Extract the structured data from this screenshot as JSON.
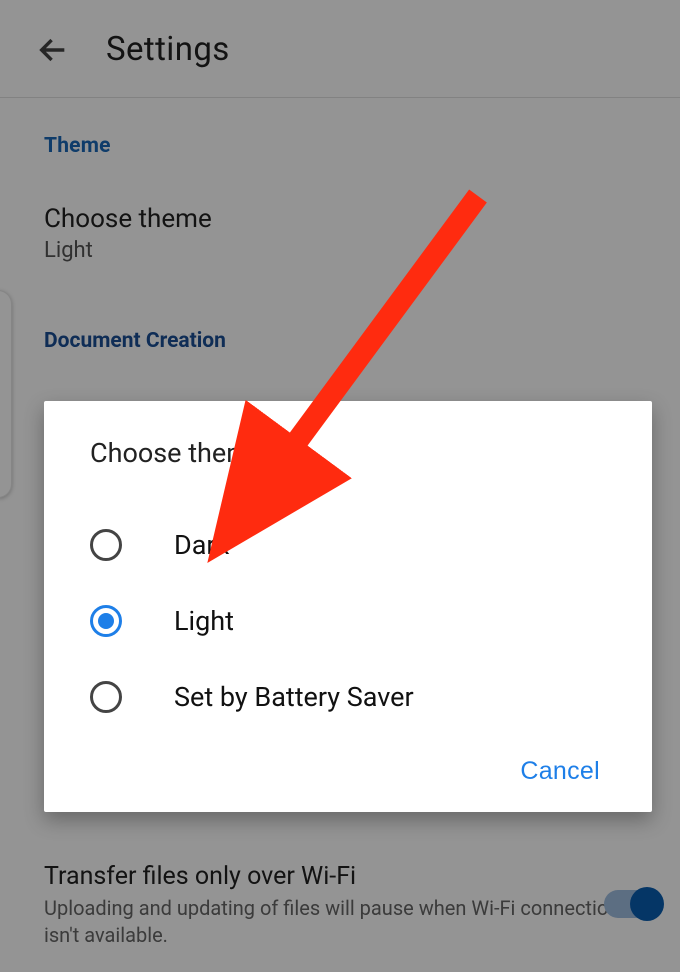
{
  "header": {
    "title": "Settings"
  },
  "sections": {
    "theme_head": "Theme",
    "choose_theme_title": "Choose theme",
    "choose_theme_value": "Light",
    "doc_creation_head": "Document Creation"
  },
  "bottom": {
    "title": "Transfer files only over Wi-Fi",
    "subtitle": "Uploading and updating of files will pause when Wi-Fi connection isn't available."
  },
  "dialog": {
    "title": "Choose theme",
    "options": {
      "0": {
        "label": "Dark",
        "checked": false
      },
      "1": {
        "label": "Light",
        "checked": true
      },
      "2": {
        "label": "Set by Battery Saver",
        "checked": false
      }
    },
    "cancel": "Cancel"
  },
  "annotation": {
    "color": "#ff2b0f"
  }
}
